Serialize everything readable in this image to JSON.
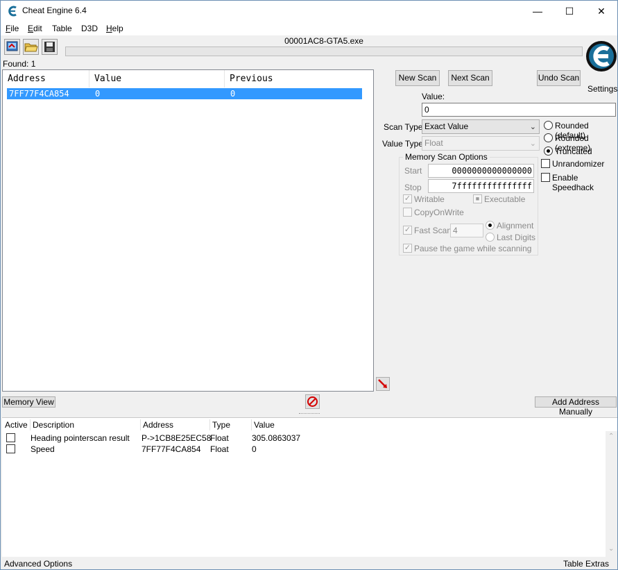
{
  "window": {
    "title": "Cheat Engine 6.4",
    "minimize_glyph": "—",
    "maximize_glyph": "☐",
    "close_glyph": "✕"
  },
  "menu": [
    {
      "label": "File",
      "accel": "F"
    },
    {
      "label": "Edit",
      "accel": "E"
    },
    {
      "label": "Table",
      "accel": ""
    },
    {
      "label": "D3D",
      "accel": ""
    },
    {
      "label": "Help",
      "accel": "H"
    }
  ],
  "toolbar": {
    "icons": [
      "select-process-icon",
      "open-file-icon",
      "save-file-icon"
    ]
  },
  "process_name": "00001AC8-GTA5.exe",
  "found_label": "Found: 1",
  "results": {
    "columns": [
      "Address",
      "Value",
      "Previous"
    ],
    "rows": [
      {
        "address": "7FF77F4CA854",
        "value": "0",
        "previous": "0"
      }
    ]
  },
  "scan": {
    "new_scan": "New Scan",
    "next_scan": "Next Scan",
    "undo_scan": "Undo Scan",
    "settings": "Settings",
    "value_label": "Value:",
    "value_input": "0",
    "scan_type_label": "Scan Type",
    "scan_type_value": "Exact Value",
    "value_type_label": "Value Type",
    "value_type_value": "Float"
  },
  "rounding": {
    "options": [
      "Rounded (default)",
      "Rounded (extreme)",
      "Truncated"
    ],
    "selected": "Truncated"
  },
  "unrandomizer": {
    "label": "Unrandomizer",
    "checked": false
  },
  "speedhack": {
    "label": "Enable Speedhack",
    "checked": false
  },
  "memory_scan": {
    "title": "Memory Scan Options",
    "start_label": "Start",
    "start_value": "0000000000000000",
    "stop_label": "Stop",
    "stop_value": "7fffffffffffffff",
    "writable": "Writable",
    "executable": "Executable",
    "copy_on_write": "CopyOnWrite",
    "fast_scan": "Fast Scan",
    "fast_scan_value": "4",
    "alignment": "Alignment",
    "last_digits": "Last Digits",
    "pause": "Pause the game while scanning"
  },
  "memory_view": "Memory View",
  "add_address": "Add Address Manually",
  "address_list": {
    "columns": [
      "Active",
      "Description",
      "Address",
      "Type",
      "Value"
    ],
    "rows": [
      {
        "description": "Heading pointerscan result",
        "address": "P->1CB8E25EC58",
        "type": "Float",
        "value": "305.0863037"
      },
      {
        "description": "Speed",
        "address": "7FF77F4CA854",
        "type": "Float",
        "value": "0"
      }
    ]
  },
  "status": {
    "left": "Advanced Options",
    "right": "Table Extras"
  },
  "colors": {
    "selection": "#3399ff",
    "accent": "#1a6f9a",
    "stop_red": "#d40000"
  }
}
